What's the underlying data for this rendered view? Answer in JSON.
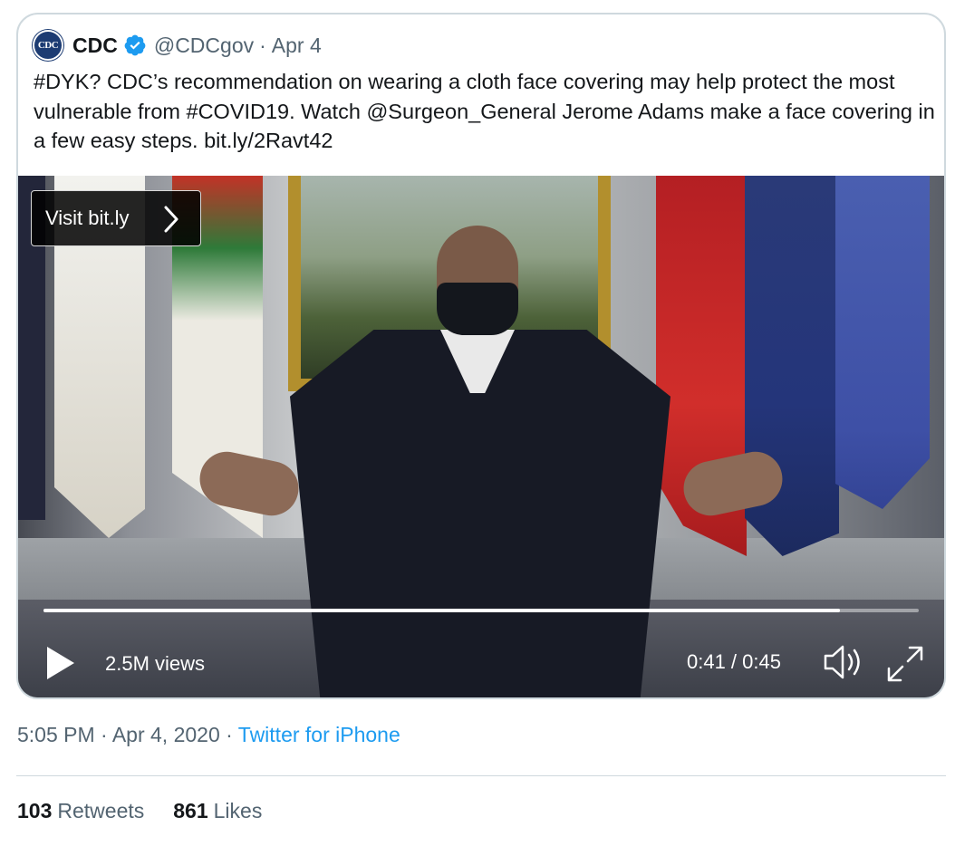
{
  "tweet": {
    "author_name": "CDC",
    "logo_text": "CDC",
    "handle": "@CDCgov",
    "separator": "·",
    "date": "Apr 4",
    "text": "#DYK? CDC’s recommendation on wearing a cloth face covering may help protect the most vulnerable from #COVID19. Watch @Surgeon_General Jerome Adams make a face covering in a few easy steps. bit.ly/2Ravt42"
  },
  "video": {
    "visit_label": "Visit bit.ly",
    "views": "2.5M views",
    "time": "0:41 / 0:45",
    "progress": 0.91
  },
  "meta": {
    "timestamp": "5:05 PM · Apr 4, 2020",
    "separator": "·",
    "source": "Twitter for iPhone"
  },
  "stats": {
    "retweets_count": "103",
    "retweets_label": "Retweets",
    "likes_count": "861",
    "likes_label": "Likes"
  },
  "colors": {
    "verified": "#1d9bf0",
    "link": "#1d9bf0",
    "secondary_text": "#536471",
    "border": "#cfd9de"
  },
  "icons": [
    "cdc-logo-icon",
    "verified-badge-icon",
    "chevron-right-icon",
    "play-icon",
    "volume-icon",
    "fullscreen-icon"
  ]
}
